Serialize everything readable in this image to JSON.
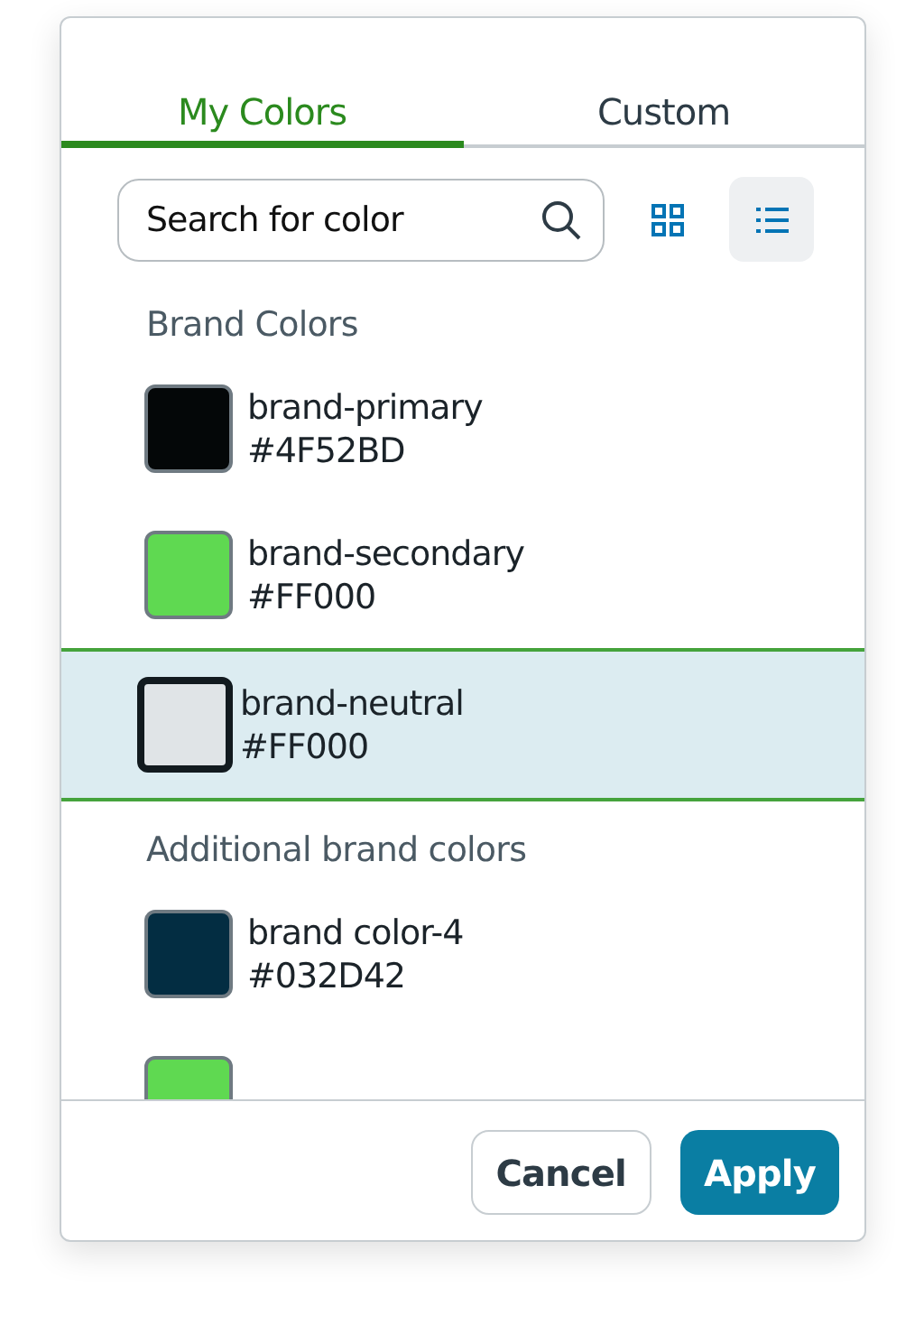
{
  "tabs": [
    {
      "label": "My Colors",
      "selected": true
    },
    {
      "label": "Custom",
      "selected": false
    }
  ],
  "search": {
    "placeholder": "Search for color"
  },
  "view_toggle": [
    {
      "kind": "grid",
      "selected": false
    },
    {
      "kind": "list",
      "selected": true
    }
  ],
  "groups": [
    {
      "title": "Brand Colors",
      "colors": [
        {
          "name": "brand-primary",
          "hex": "#4F52BD",
          "color": "#040708",
          "selected": false
        },
        {
          "name": "brand-secondary",
          "hex": "#FF000",
          "color": "#5fd951",
          "selected": false
        },
        {
          "name": "brand-neutral",
          "hex": "#FF000",
          "color": "#e0e4e7",
          "selected": true
        }
      ]
    },
    {
      "title": "Additional brand colors",
      "colors": [
        {
          "name": "brand color-4",
          "hex": "#032D42",
          "color": "#032d42",
          "selected": false
        },
        {
          "color": "#5fd951",
          "selected": false
        }
      ]
    }
  ],
  "buttons": [
    {
      "label": "Cancel",
      "kind": "secondary"
    },
    {
      "label": "Apply",
      "kind": "primary"
    }
  ]
}
